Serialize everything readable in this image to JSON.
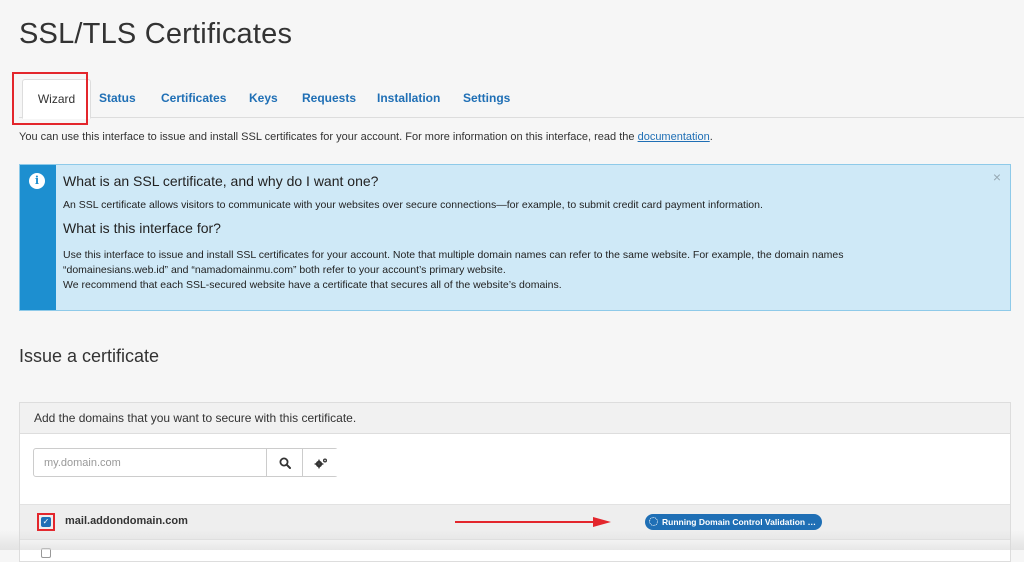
{
  "page": {
    "title": "SSL/TLS Certificates"
  },
  "tabs": [
    {
      "label": "Wizard"
    },
    {
      "label": "Status"
    },
    {
      "label": "Certificates"
    },
    {
      "label": "Keys"
    },
    {
      "label": "Requests"
    },
    {
      "label": "Installation"
    },
    {
      "label": "Settings"
    }
  ],
  "intro": {
    "text": "You can use this interface to issue and install SSL certificates for your account. For more information on this interface, read the",
    "link": "documentation",
    "end": "."
  },
  "info": {
    "h1": "What is an SSL certificate, and why do I want one?",
    "p1": "An SSL certificate allows visitors to communicate with your websites over secure connections—for example, to submit credit card payment information.",
    "h2": "What is this interface for?",
    "p2a": "Use this interface to issue and install SSL certificates for your account. Note that multiple domain names can refer to the same website. For example, the domain names",
    "p2b": "“domainesians.web.id” and “namadomainmu.com” both refer to your account’s primary website.",
    "p3": "We recommend that each SSL-secured website have a certificate that secures all of the website’s domains.",
    "close": "×"
  },
  "issue": {
    "title": "Issue a certificate",
    "panel_heading": "Add the domains that you want to secure with this certificate.",
    "search_placeholder": "my.domain.com",
    "domains": [
      {
        "name": "mail.addondomain.com",
        "checked": true,
        "status": "Running Domain Control Validation …"
      }
    ]
  },
  "colors": {
    "accent": "#1f6fb5",
    "annotation": "#e3262c",
    "info_bg": "#cfe9f7",
    "info_strip": "#1d8fd0"
  }
}
